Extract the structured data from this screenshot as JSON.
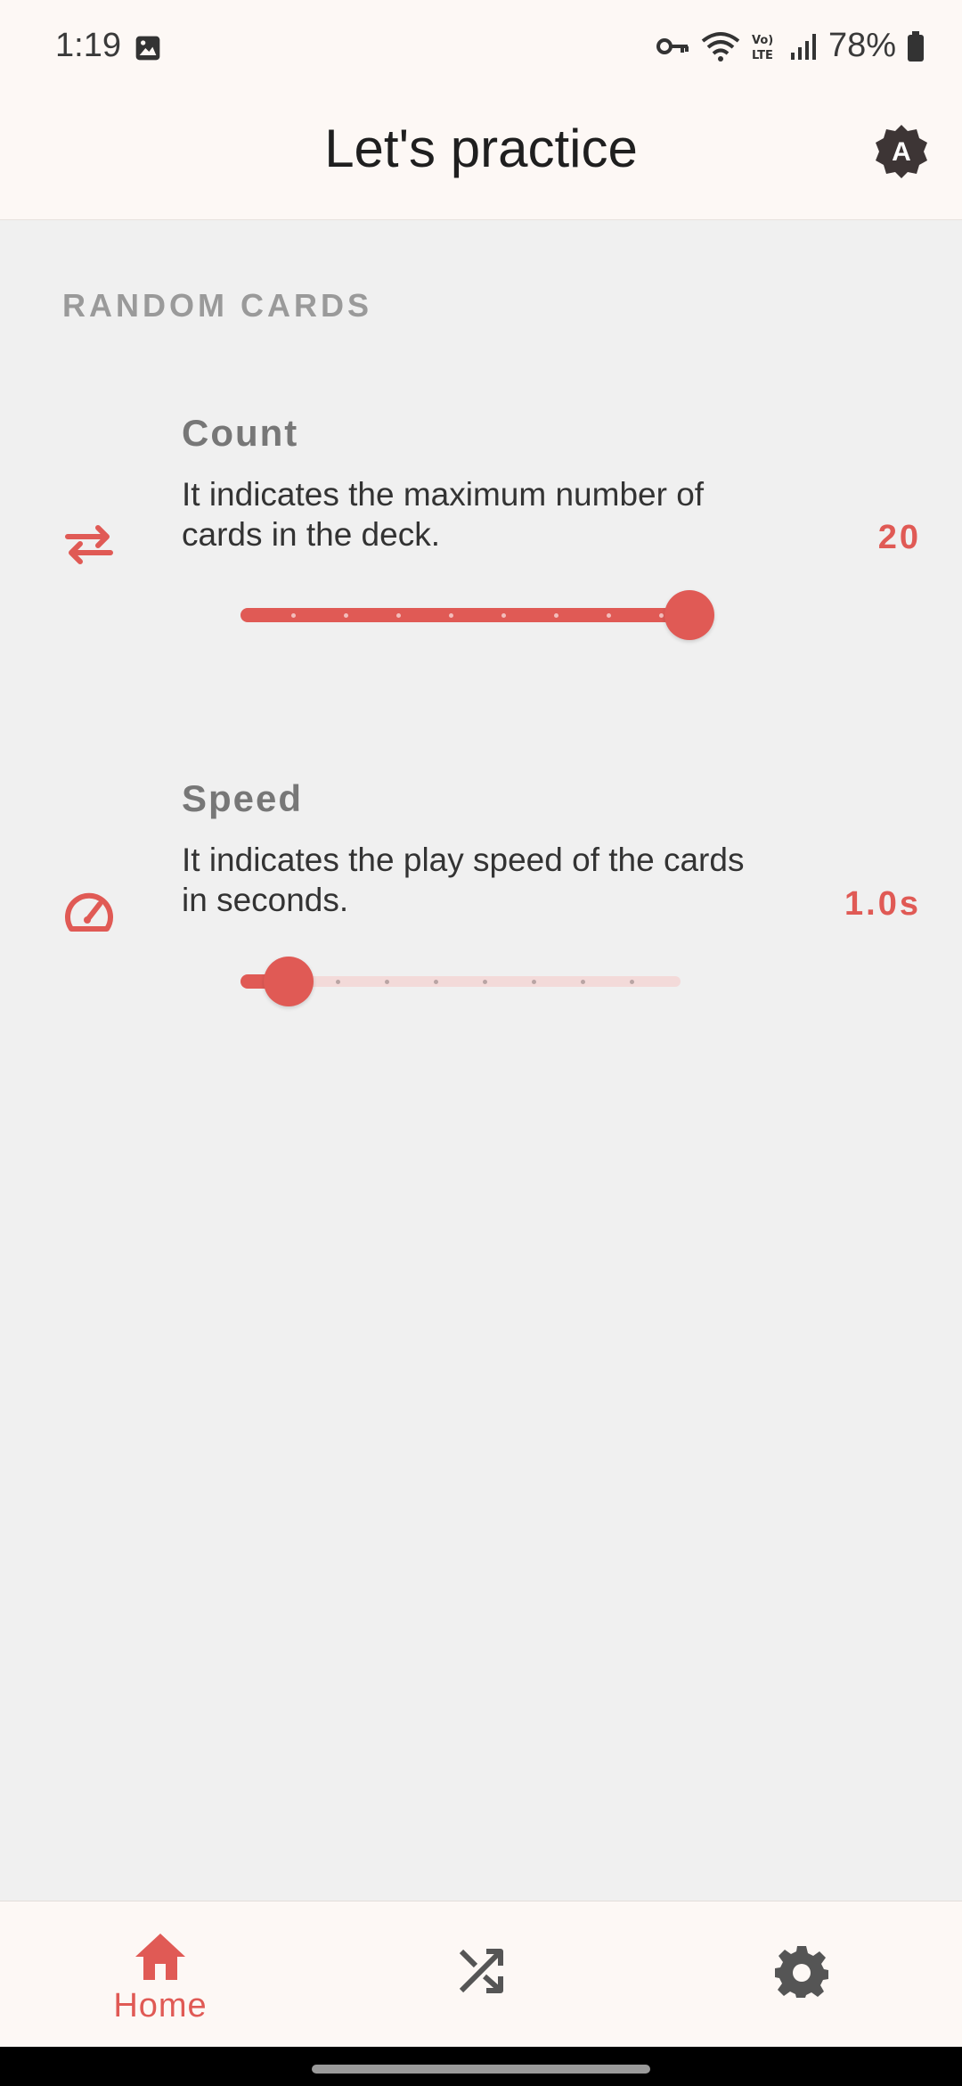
{
  "status": {
    "time": "1:19",
    "battery": "78%",
    "icons": [
      "image-icon",
      "vpn-key-icon",
      "wifi-icon",
      "volte-icon",
      "signal-icon",
      "battery-icon"
    ]
  },
  "appbar": {
    "title": "Let's practice",
    "badge_letter": "A"
  },
  "section": {
    "header": "RANDOM CARDS"
  },
  "settings": [
    {
      "title": "Count",
      "description": "It indicates the maximum number of cards in the deck.",
      "value": "20",
      "icon": "repeat-arrows-icon",
      "slider_fraction": 1.0,
      "steps": 9
    },
    {
      "title": "Speed",
      "description": "It indicates the play speed of the cards in seconds.",
      "value": "1.0s",
      "icon": "speedometer-icon",
      "slider_fraction": 0.11,
      "steps": 9
    }
  ],
  "nav": {
    "home_label": "Home",
    "items": [
      "home-icon",
      "shuffle-icon",
      "settings-gear-icon"
    ]
  },
  "colors": {
    "accent": "#e05a55",
    "track_inactive": "#f3dad9",
    "background": "#f0f0f0",
    "surface": "#fdf8f5"
  }
}
